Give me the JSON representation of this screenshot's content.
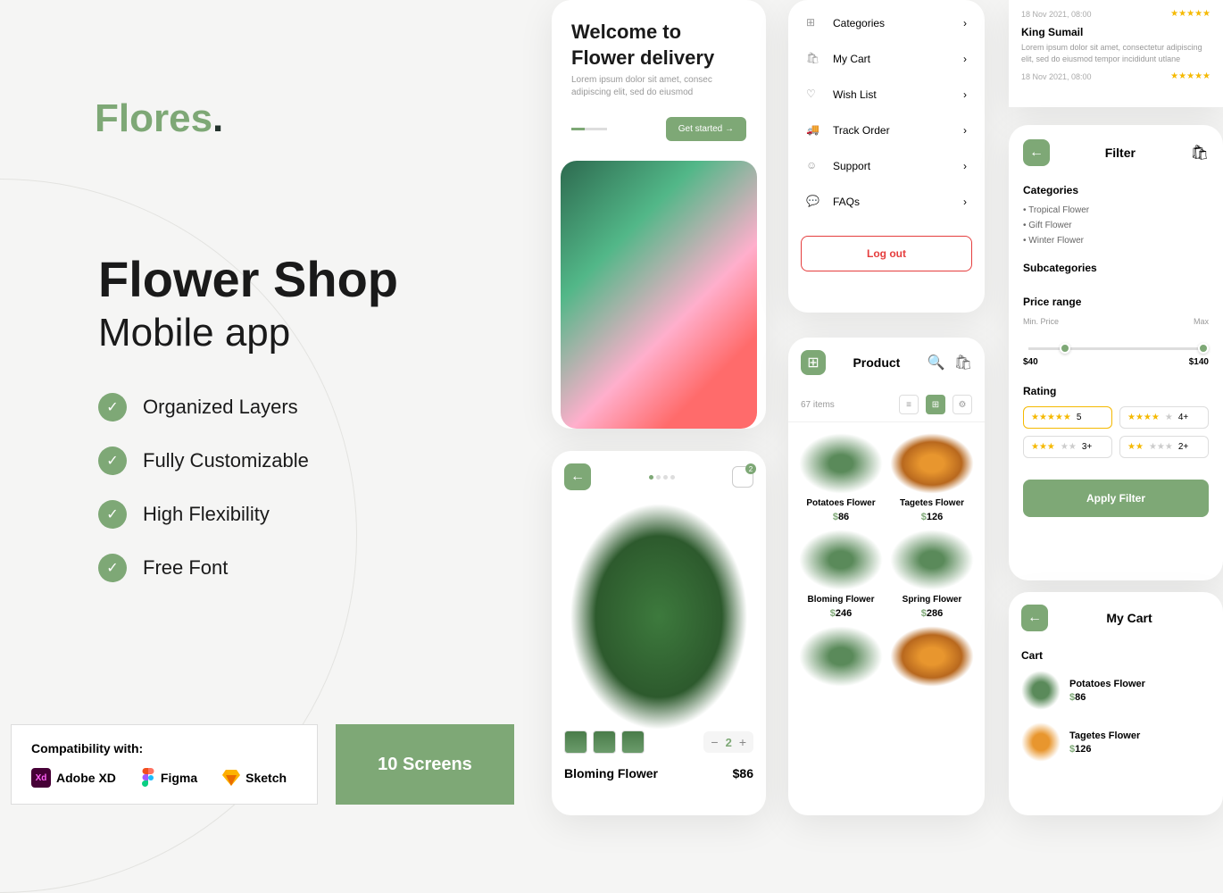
{
  "logo": "Flores",
  "headline": "Flower Shop",
  "subheadline": "Mobile app",
  "features": [
    "Organized Layers",
    "Fully Customizable",
    "High Flexibility",
    "Free Font"
  ],
  "compat": {
    "title": "Compatibility with:",
    "tools": [
      "Adobe XD",
      "Figma",
      "Sketch"
    ]
  },
  "screens_badge": "10 Screens",
  "welcome": {
    "title1": "Welcome to",
    "title2": "Flower delivery",
    "subtitle": "Lorem ipsum dolor sit amet, consec adipiscing elit, sed do eiusmod",
    "cta": "Get started →"
  },
  "detail": {
    "qty": "2",
    "name": "Bloming Flower",
    "price": "$86"
  },
  "menu": {
    "items": [
      "Categories",
      "My Cart",
      "Wish List",
      "Track Order",
      "Support",
      "FAQs"
    ],
    "logout": "Log out"
  },
  "product": {
    "title": "Product",
    "count": "67 items",
    "items": [
      {
        "name": "Potatoes Flower",
        "price": "86"
      },
      {
        "name": "Tagetes Flower",
        "price": "126"
      },
      {
        "name": "Bloming Flower",
        "price": "246"
      },
      {
        "name": "Spring Flower",
        "price": "286"
      }
    ]
  },
  "reviews": {
    "date1": "18 Nov 2021, 08:00",
    "name": "King Sumail",
    "text": "Lorem ipsum dolor sit amet, consectetur adipiscing elit, sed do eiusmod tempor incididunt utlane",
    "date2": "18 Nov 2021, 08:00"
  },
  "filter": {
    "title": "Filter",
    "cat_title": "Categories",
    "cats": [
      "Tropical Flower",
      "Gift Flower",
      "Winter Flower"
    ],
    "subcat_title": "Subcategories",
    "price_title": "Price range",
    "min_lbl": "Min. Price",
    "max_lbl": "Max",
    "min": "$40",
    "max": "$140",
    "rating_title": "Rating",
    "ratings": [
      "5",
      "4+",
      "3+",
      "2+"
    ],
    "apply": "Apply Filter"
  },
  "cart": {
    "title": "My Cart",
    "section": "Cart",
    "items": [
      {
        "name": "Potatoes Flower",
        "price": "86"
      },
      {
        "name": "Tagetes Flower",
        "price": "126"
      }
    ]
  }
}
